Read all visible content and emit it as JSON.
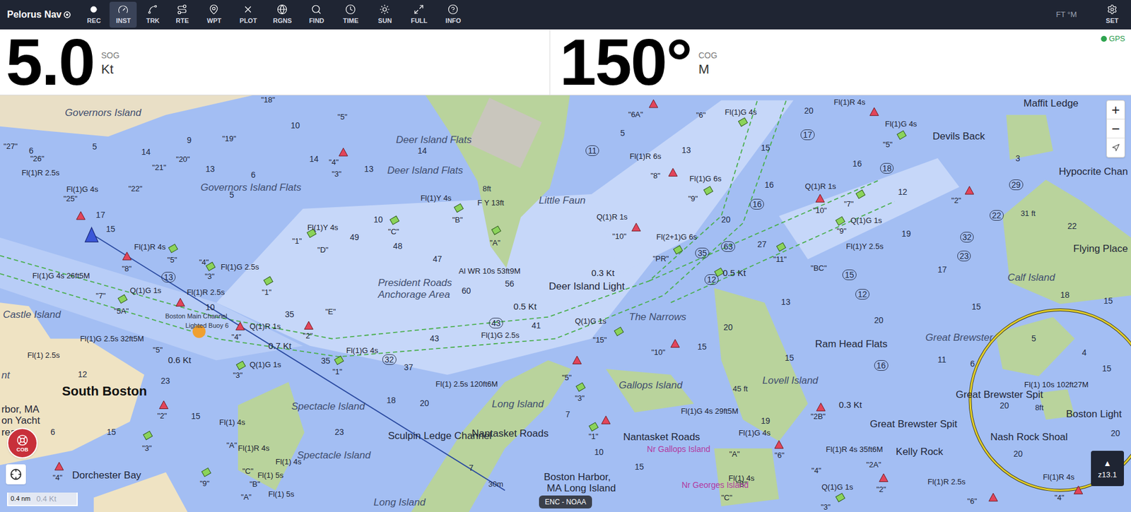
{
  "toolbar": {
    "title": "Pelorus Nav",
    "tools": [
      {
        "label": "REC",
        "selected": false
      },
      {
        "label": "INST",
        "selected": true
      },
      {
        "label": "TRK",
        "selected": false
      },
      {
        "label": "RTE",
        "selected": false
      },
      {
        "label": "WPT",
        "selected": false
      },
      {
        "label": "PLOT",
        "selected": false
      },
      {
        "label": "RGNS",
        "selected": false
      },
      {
        "label": "FIND",
        "selected": false
      },
      {
        "label": "TIME",
        "selected": false
      },
      {
        "label": "SUN",
        "selected": false
      },
      {
        "label": "FULL",
        "selected": false
      },
      {
        "label": "INFO",
        "selected": false
      }
    ],
    "units": "FT °M",
    "settings_label": "SET"
  },
  "instruments": [
    {
      "value": "5.0",
      "label": "SOG",
      "unit": "Kt"
    },
    {
      "value": "150°",
      "label": "COG",
      "unit": "M"
    }
  ],
  "gps": {
    "label": "GPS",
    "on": true
  },
  "map": {
    "places": [
      {
        "text": "Governors Island",
        "kind": "place"
      },
      {
        "text": "Deer Island Flats",
        "kind": "place"
      },
      {
        "text": "Deer Island Flats",
        "kind": "place"
      },
      {
        "text": "Governors Island Flats",
        "kind": "place"
      },
      {
        "text": "Little Faun",
        "kind": "place"
      },
      {
        "text": "President Roads",
        "kind": "place"
      },
      {
        "text": "Anchorage Area",
        "kind": "place"
      },
      {
        "text": "Deer Island Light",
        "kind": "landmark"
      },
      {
        "text": "The Narrows",
        "kind": "place"
      },
      {
        "text": "Castle Island",
        "kind": "place"
      },
      {
        "text": "South Boston",
        "kind": "region"
      },
      {
        "text": "Spectacle Island",
        "kind": "place"
      },
      {
        "text": "Spectacle Island",
        "kind": "place"
      },
      {
        "text": "Long Island",
        "kind": "place"
      },
      {
        "text": "Long Island",
        "kind": "place"
      },
      {
        "text": "Sculpin Ledge Channel",
        "kind": "landmark"
      },
      {
        "text": "Nantasket Roads",
        "kind": "landmark"
      },
      {
        "text": "Nantasket Roads",
        "kind": "landmark"
      },
      {
        "text": "Gallops Island",
        "kind": "place"
      },
      {
        "text": "Lovell Island",
        "kind": "place"
      },
      {
        "text": "Ram Head Flats",
        "kind": "landmark"
      },
      {
        "text": "Great Brewster",
        "kind": "place"
      },
      {
        "text": "Great Brewster Spit",
        "kind": "landmark"
      },
      {
        "text": "Great Brewster Spit",
        "kind": "landmark"
      },
      {
        "text": "Kelly Rock",
        "kind": "landmark"
      },
      {
        "text": "Nash Rock Shoal",
        "kind": "landmark"
      },
      {
        "text": "Boston Light",
        "kind": "landmark"
      },
      {
        "text": "Calf Island",
        "kind": "place"
      },
      {
        "text": "Flying Place",
        "kind": "landmark"
      },
      {
        "text": "Hypocrite Chan",
        "kind": "landmark"
      },
      {
        "text": "Maffit Ledge",
        "kind": "landmark"
      },
      {
        "text": "Devils Back",
        "kind": "landmark"
      },
      {
        "text": "Dorchester Bay",
        "kind": "landmark"
      },
      {
        "text": "Boston Harbor,",
        "kind": "landmark"
      },
      {
        "text": "MA Long Island",
        "kind": "landmark"
      },
      {
        "text": "rbor, MA",
        "kind": "landmark"
      },
      {
        "text": "on Yacht",
        "kind": "landmark"
      },
      {
        "text": "rea",
        "kind": "landmark"
      },
      {
        "text": "nt",
        "kind": "place"
      },
      {
        "text": "Boston Main Channel",
        "kind": "small"
      },
      {
        "text": "Lighted Buoy 6",
        "kind": "small"
      },
      {
        "text": "Nr Gallops Island",
        "kind": "note"
      },
      {
        "text": "Nr Georges Island",
        "kind": "note"
      }
    ],
    "lights": [
      "Fl(1)R 2.5s",
      "Fl(1)G 4s",
      "Fl(1)R 4s",
      "Fl(1)G 4s 26ft5M",
      "Q(1)G 1s",
      "Fl(1)R 2.5s",
      "Fl(1)G 2.5s",
      "Fl(1)G 2.5s 32ft5M",
      "Q(1)R 1s",
      "Q(1)G 1s",
      "Fl(1)G 4s",
      "Fl(1)Y 4s",
      "Fl(1)Y 4s",
      "F Y 13ft",
      "Al WR 10s 53ft9M",
      "Q(1)R 1s",
      "Fl(1)R 6s",
      "Fl(1)G 6s",
      "Fl(1)G 4s",
      "Fl(1)R 4s",
      "Fl(1)G 4s",
      "Q(1)R 1s",
      "Q(1)G 1s",
      "Fl(1)Y 2.5s",
      "Fl(2+1)G 6s",
      "Q(1)G 1s",
      "Fl(1)G 2.5s",
      "Fl(1) 2.5s 120ft6M",
      "Fl(1)G 4s 29ft5M",
      "Fl(1)G 4s",
      "Fl(1)R 4s 35ft6M",
      "Fl(1) 10s 102ft27M",
      "Fl(1)R 2.5s",
      "Q(1)G 1s",
      "Fl(1)R 4s",
      "Fl(1) 2.5s",
      "Fl(1) 4s",
      "Fl(1) 4s",
      "Fl(1) 5s",
      "Fl(1) 5s",
      "Fl(1)R 4s",
      "Fl(1) 4s"
    ],
    "buoys": [
      "\"18\"",
      "\"5\"",
      "\"19\"",
      "\"20\"",
      "\"21\"",
      "\"22\"",
      "\"25\"",
      "\"27\"",
      "\"26\"",
      "\"4\"",
      "\"3\"",
      "\"C\"",
      "\"B\"",
      "\"A\"",
      "\"D\"",
      "\"1\"",
      "\"E\"",
      "\"1\"",
      "\"8\"",
      "\"5\"",
      "\"4\"",
      "\"3\"",
      "\"2\"",
      "\"4\"",
      "\"3\"",
      "\"1\"",
      "\"5A\"",
      "\"5\"",
      "\"7\"",
      "\"2\"",
      "\"3\"",
      "\"4\"",
      "\"9\"",
      "\"6A\"",
      "\"6\"",
      "\"8\"",
      "\"9\"",
      "\"10\"",
      "\"PR\"",
      "\"10\"",
      "\"7\"",
      "\"5\"",
      "\"9\"",
      "\"11\"",
      "\"BC\"",
      "\"15\"",
      "\"5\"",
      "\"3\"",
      "\"10\"",
      "\"1\"",
      "\"2B\"",
      "\"4\"",
      "\"6\"",
      "\"2A\"",
      "\"2\"",
      "\"A\"",
      "\"B\"",
      "\"C\"",
      "\"2\"",
      "\"6\"",
      "\"4\"",
      "\"A\"",
      "\"B\"",
      "\"C\"",
      "\"A\"",
      "\"3\""
    ],
    "soundings": [
      {
        "text": "11",
        "circled": true
      },
      {
        "text": "17",
        "circled": true
      },
      {
        "text": "18",
        "circled": true
      },
      {
        "text": "63",
        "circled": true
      },
      {
        "text": "16",
        "circled": true
      },
      {
        "text": "16",
        "circled": true
      },
      {
        "text": "43",
        "circled": true
      },
      {
        "text": "32",
        "circled": true
      },
      {
        "text": "35",
        "circled": true
      },
      {
        "text": "13",
        "circled": true
      },
      {
        "text": "22",
        "circled": true
      },
      {
        "text": "32",
        "circled": true
      },
      {
        "text": "23",
        "circled": true
      },
      {
        "text": "29",
        "circled": true
      },
      {
        "text": "12",
        "circled": true
      },
      {
        "text": "15",
        "circled": true
      },
      {
        "text": "12",
        "circled": true
      },
      {
        "text": "6",
        "circled": false
      },
      {
        "text": "5",
        "circled": false
      },
      {
        "text": "14",
        "circled": false
      },
      {
        "text": "17",
        "circled": false
      },
      {
        "text": "15",
        "circled": false
      },
      {
        "text": "9",
        "circled": false
      },
      {
        "text": "13",
        "circled": false
      },
      {
        "text": "5",
        "circled": false
      },
      {
        "text": "6",
        "circled": false
      },
      {
        "text": "10",
        "circled": false
      },
      {
        "text": "14",
        "circled": false
      },
      {
        "text": "13",
        "circled": false
      },
      {
        "text": "10",
        "circled": false
      },
      {
        "text": "49",
        "circled": false
      },
      {
        "text": "48",
        "circled": false
      },
      {
        "text": "47",
        "circled": false
      },
      {
        "text": "60",
        "circled": false
      },
      {
        "text": "56",
        "circled": false
      },
      {
        "text": "41",
        "circled": false
      },
      {
        "text": "43",
        "circled": false
      },
      {
        "text": "37",
        "circled": false
      },
      {
        "text": "35",
        "circled": false
      },
      {
        "text": "35",
        "circled": false
      },
      {
        "text": "10",
        "circled": false
      },
      {
        "text": "23",
        "circled": false
      },
      {
        "text": "15",
        "circled": false
      },
      {
        "text": "15",
        "circled": false
      },
      {
        "text": "6",
        "circled": false
      },
      {
        "text": "12",
        "circled": false
      },
      {
        "text": "20",
        "circled": false
      },
      {
        "text": "18",
        "circled": false
      },
      {
        "text": "23",
        "circled": false
      },
      {
        "text": "7",
        "circled": false
      },
      {
        "text": "10",
        "circled": false
      },
      {
        "text": "7",
        "circled": false
      },
      {
        "text": "15",
        "circled": false
      },
      {
        "text": "15",
        "circled": false
      },
      {
        "text": "20",
        "circled": false
      },
      {
        "text": "19",
        "circled": false
      },
      {
        "text": "15",
        "circled": false
      },
      {
        "text": "20",
        "circled": false
      },
      {
        "text": "11",
        "circled": false
      },
      {
        "text": "6",
        "circled": false
      },
      {
        "text": "20",
        "circled": false
      },
      {
        "text": "20",
        "circled": false
      },
      {
        "text": "15",
        "circled": false
      },
      {
        "text": "20",
        "circled": false
      },
      {
        "text": "4",
        "circled": false
      },
      {
        "text": "5",
        "circled": false
      },
      {
        "text": "12",
        "circled": false
      },
      {
        "text": "19",
        "circled": false
      },
      {
        "text": "17",
        "circled": false
      },
      {
        "text": "15",
        "circled": false
      },
      {
        "text": "13",
        "circled": false
      },
      {
        "text": "16",
        "circled": false
      },
      {
        "text": "20",
        "circled": false
      },
      {
        "text": "15",
        "circled": false
      },
      {
        "text": "13",
        "circled": false
      },
      {
        "text": "5",
        "circled": false
      },
      {
        "text": "16",
        "circled": false
      },
      {
        "text": "20",
        "circled": false
      },
      {
        "text": "27",
        "circled": false
      },
      {
        "text": "15",
        "circled": false
      },
      {
        "text": "18",
        "circled": false
      },
      {
        "text": "22",
        "circled": false
      },
      {
        "text": "3",
        "circled": false
      },
      {
        "text": "14",
        "circled": false
      }
    ],
    "heights": [
      "8ft",
      "45 ft",
      "31 ft",
      "8ft",
      "30m"
    ],
    "currents": [
      "0.3 Kt",
      "0.5 Kt",
      "0.7 Kt",
      "0.6 Kt",
      "0.5 Kt",
      "0.3 Kt"
    ],
    "zoom_in": "+",
    "zoom_out": "−",
    "cob": "COB",
    "scale": {
      "distance": "0.4 nm",
      "speed": "0.4 Kt"
    },
    "attribution": "ENC - NOAA",
    "zoom_marker": "▲",
    "zoom_level": "z13.1"
  }
}
